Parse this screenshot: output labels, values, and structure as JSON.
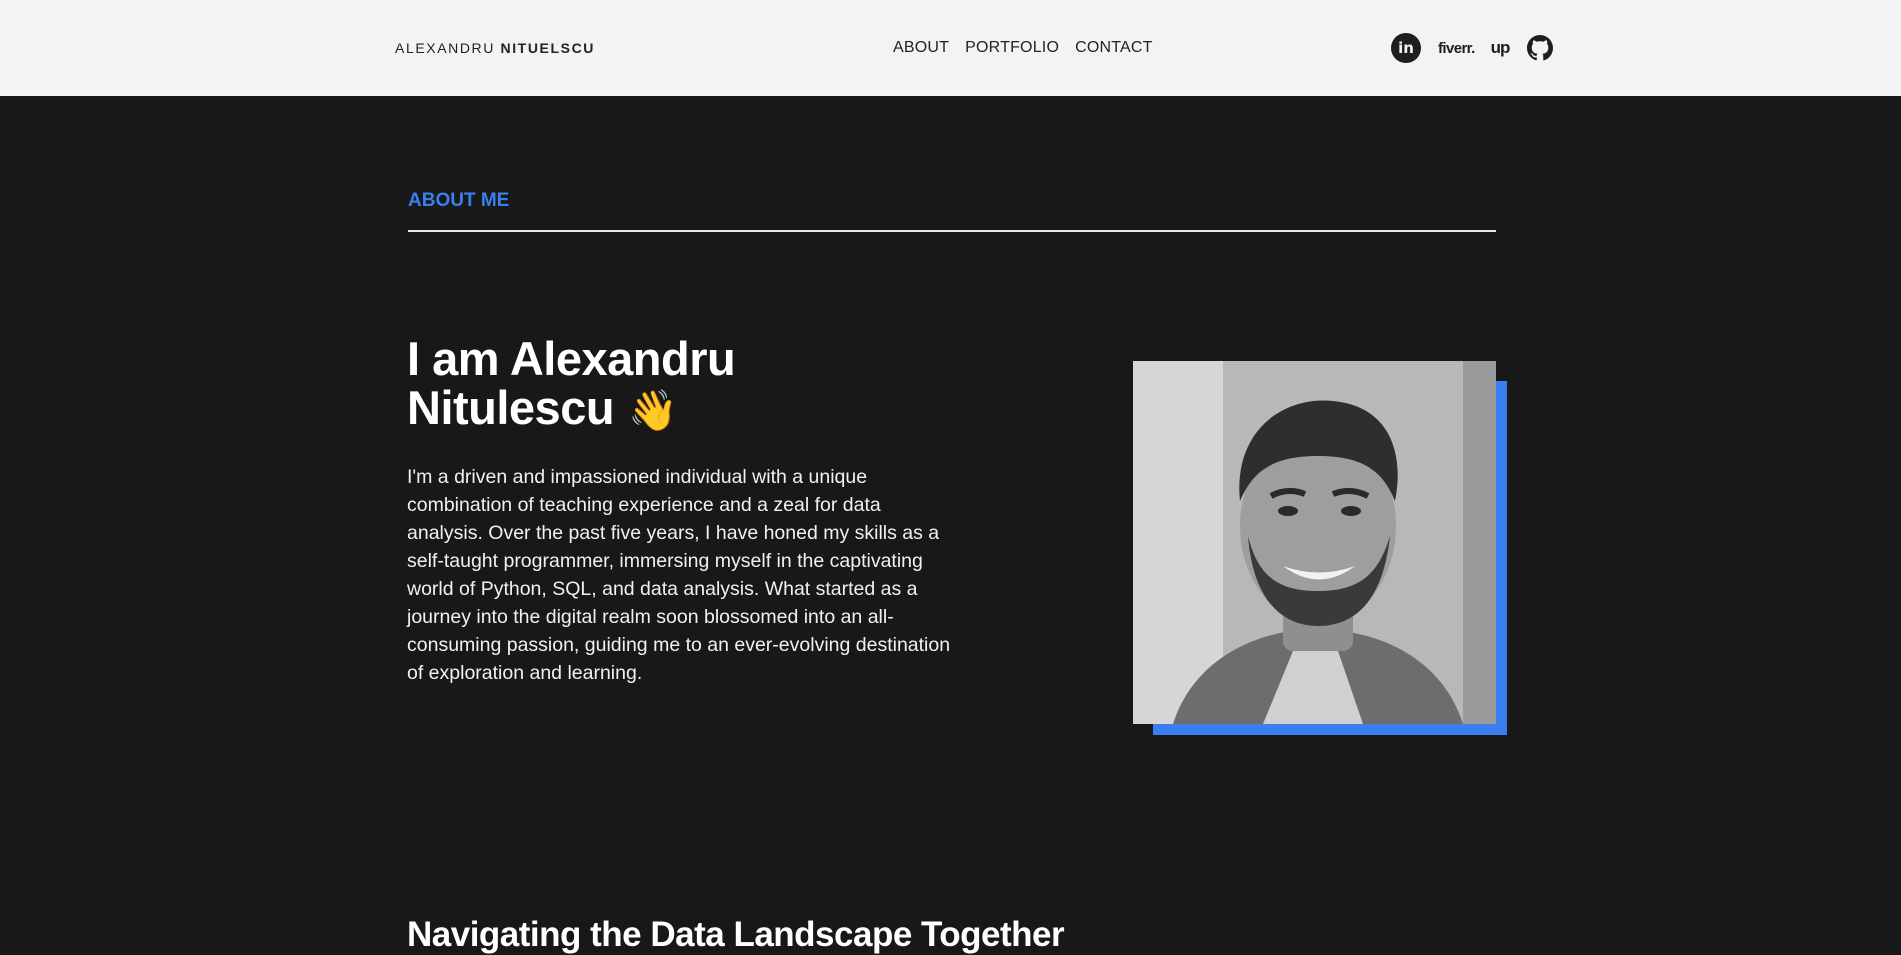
{
  "header": {
    "logo_first": "ALEXANDRU",
    "logo_last": "NITUELSCU",
    "nav": [
      "ABOUT",
      "PORTFOLIO",
      "CONTACT"
    ],
    "social": {
      "linkedin": "in",
      "fiverr": "fiverr.",
      "upwork": "up"
    }
  },
  "about": {
    "section_title": "ABOUT ME",
    "heading_line1": "I am Alexandru",
    "heading_line2": "Nitulescu",
    "wave_emoji": "👋",
    "bio": "I'm a driven and impassioned individual with a unique combination of teaching experience and a zeal for data analysis. Over the past five years, I have honed my skills as a self-taught programmer, immersing myself in the captivating world of Python, SQL, and data analysis. What started as a journey into the digital realm soon blossomed into an all-consuming passion, guiding me to an ever-evolving destination of exploration and learning."
  },
  "next_section": {
    "title": "Navigating the Data Landscape Together"
  },
  "colors": {
    "accent": "#3b7fea",
    "background": "#181818",
    "header_bg": "#f3f3f3"
  },
  "icons": [
    "linkedin-icon",
    "fiverr-icon",
    "upwork-icon",
    "github-icon",
    "wave-icon"
  ]
}
